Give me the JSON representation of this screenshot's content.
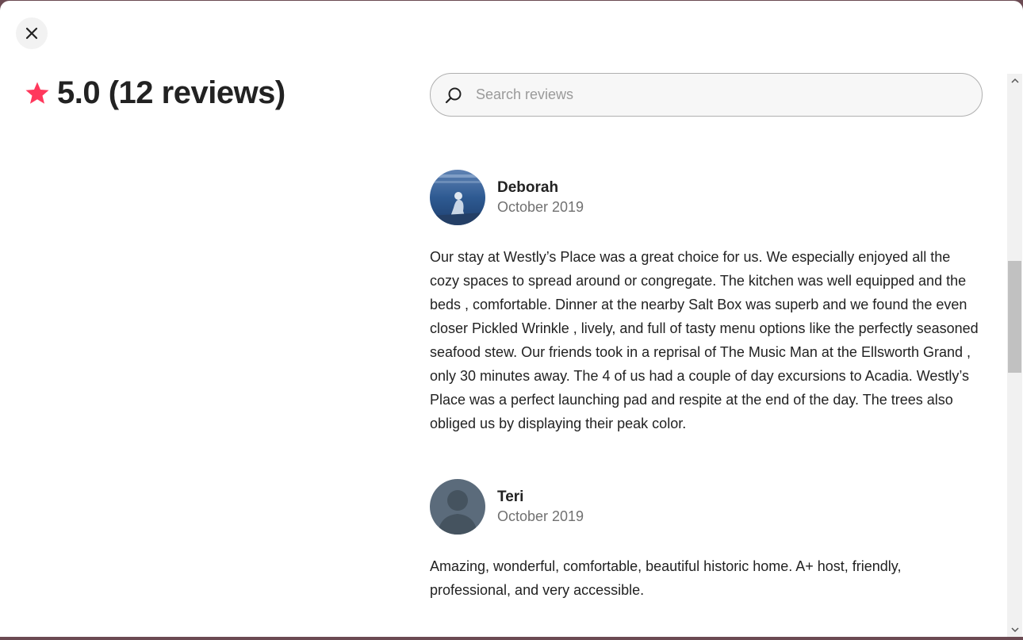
{
  "modal": {
    "close_icon": "close-icon",
    "rating": {
      "star_icon": "star-icon",
      "star_color": "#ff385c",
      "text": "5.0 (12 reviews)"
    },
    "search": {
      "icon": "search-icon",
      "placeholder": "Search reviews",
      "value": ""
    },
    "reviews": [
      {
        "name": "Deborah",
        "date": "October 2019",
        "text": "Our stay at Westly’s Place was a great choice for us. We especially enjoyed all the cozy spaces to spread around or congregate. The kitchen was well equipped and the beds , comfortable. Dinner at the nearby Salt Box was superb and we found the even closer Pickled Wrinkle , lively, and full of tasty menu options like the perfectly seasoned seafood stew. Our friends took in a reprisal of The Music Man at the Ellsworth Grand , only 30 minutes away. The 4 of us had a couple of day excursions to Acadia. Westly’s Place was a perfect launching pad and respite at the end of the day. The trees also obliged us by displaying their peak color."
      },
      {
        "name": "Teri",
        "date": "October 2019",
        "text": "Amazing, wonderful, comfortable, beautiful historic home. A+ host, friendly, professional, and very accessible."
      }
    ]
  }
}
